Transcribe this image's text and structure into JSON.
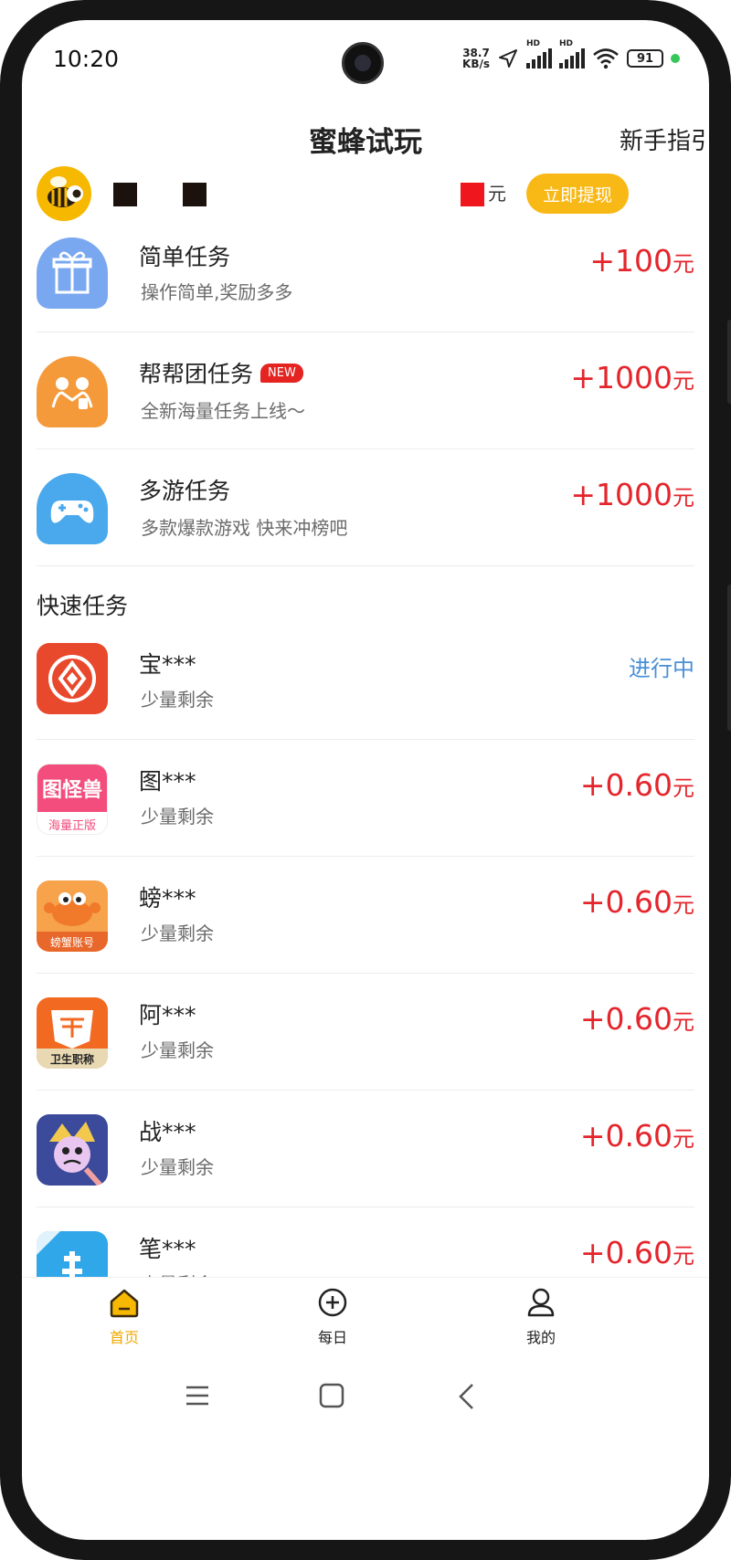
{
  "status_bar": {
    "time": "10:20",
    "net_speed_value": "38.7",
    "net_speed_unit": "KB/s",
    "hd_label_1": "HD",
    "hd_label_2": "HD",
    "battery": "91"
  },
  "header": {
    "title": "蜜蜂试玩",
    "guide_link": "新手指引"
  },
  "user": {
    "balance_unit": "元",
    "withdraw_label": "立即提现"
  },
  "main_tasks": [
    {
      "title": "简单任务",
      "subtitle": "操作简单,奖励多多",
      "reward": "+100",
      "unit": "元",
      "badge": ""
    },
    {
      "title": "帮帮团任务",
      "subtitle": "全新海量任务上线～",
      "reward": "+1000",
      "unit": "元",
      "badge": "NEW"
    },
    {
      "title": "多游任务",
      "subtitle": "多款爆款游戏 快来冲榜吧",
      "reward": "+1000",
      "unit": "元",
      "badge": ""
    }
  ],
  "quick_section": {
    "title": "快速任务",
    "items": [
      {
        "title": "宝***",
        "subtitle": "少量剩余",
        "status": "进行中"
      },
      {
        "title": "图***",
        "subtitle": "少量剩余",
        "reward": "+0.60",
        "unit": "元",
        "icon_text_1": "图怪兽",
        "icon_text_2": "海量正版"
      },
      {
        "title": "螃***",
        "subtitle": "少量剩余",
        "reward": "+0.60",
        "unit": "元",
        "icon_text": "螃蟹账号"
      },
      {
        "title": "阿***",
        "subtitle": "少量剩余",
        "reward": "+0.60",
        "unit": "元",
        "icon_text": "卫生职称"
      },
      {
        "title": "战***",
        "subtitle": "少量剩余",
        "reward": "+0.60",
        "unit": "元"
      },
      {
        "title": "笔***",
        "subtitle": "少量剩余",
        "reward": "+0.60",
        "unit": "元"
      }
    ]
  },
  "nav": {
    "tabs": [
      {
        "label": "首页",
        "active": true
      },
      {
        "label": "每日",
        "active": false
      },
      {
        "label": "我的",
        "active": false
      }
    ]
  },
  "colors": {
    "accent": "#f8b815",
    "reward": "#e4252c",
    "running": "#4a8fd6"
  }
}
